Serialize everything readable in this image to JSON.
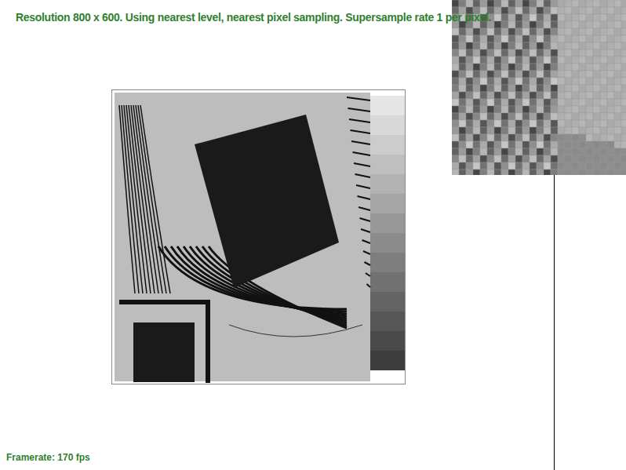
{
  "status": {
    "text": "Resolution 800 x 600. Using nearest level, nearest pixel sampling. Supersample rate 1 per pixel."
  },
  "framerate": {
    "text": "Framerate: 170 fps"
  }
}
